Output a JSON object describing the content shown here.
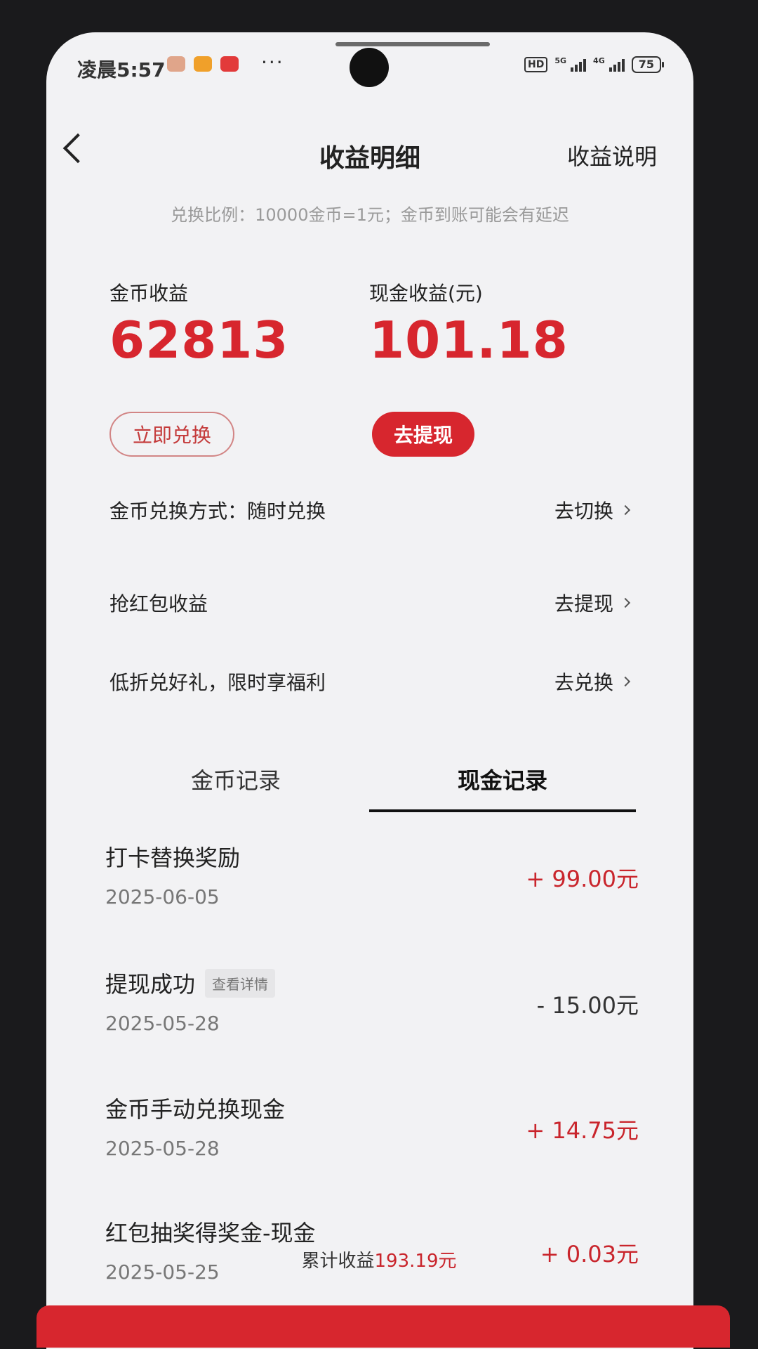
{
  "status": {
    "time": "凌晨5:57",
    "more": "···",
    "hd": "HD",
    "net1": "5G",
    "net2": "4G",
    "battery": "75"
  },
  "nav": {
    "title": "收益明细",
    "help": "收益说明"
  },
  "notice": "兑换比例：10000金币=1元；金币到账可能会有延迟",
  "coin": {
    "label": "金币收益",
    "value": "62813",
    "button": "立即兑换"
  },
  "cash": {
    "label": "现金收益(元)",
    "value": "101.18",
    "button": "去提现"
  },
  "rows": [
    {
      "label": "金币兑换方式：随时兑换",
      "action": "去切换"
    },
    {
      "label": "抢红包收益",
      "action": "去提现"
    },
    {
      "label": "低折兑好礼，限时享福利",
      "action": "去兑换"
    }
  ],
  "tabs": [
    "金币记录",
    "现金记录"
  ],
  "records": [
    {
      "name": "打卡替换奖励",
      "date": "2025-06-05",
      "amount": "+ 99.00元"
    },
    {
      "name": "提现成功",
      "tag": "查看详情",
      "date": "2025-05-28",
      "amount": "- 15.00元"
    },
    {
      "name": "金币手动兑换现金",
      "date": "2025-05-28",
      "amount": "+ 14.75元"
    },
    {
      "name": "红包抽奖得奖金-现金",
      "date": "2025-05-25",
      "amount": "+ 0.03元"
    }
  ],
  "total": {
    "label": "累计收益",
    "value": "193.19元"
  },
  "colors": {
    "accent": "#d7262e",
    "background": "#f2f2f4"
  }
}
